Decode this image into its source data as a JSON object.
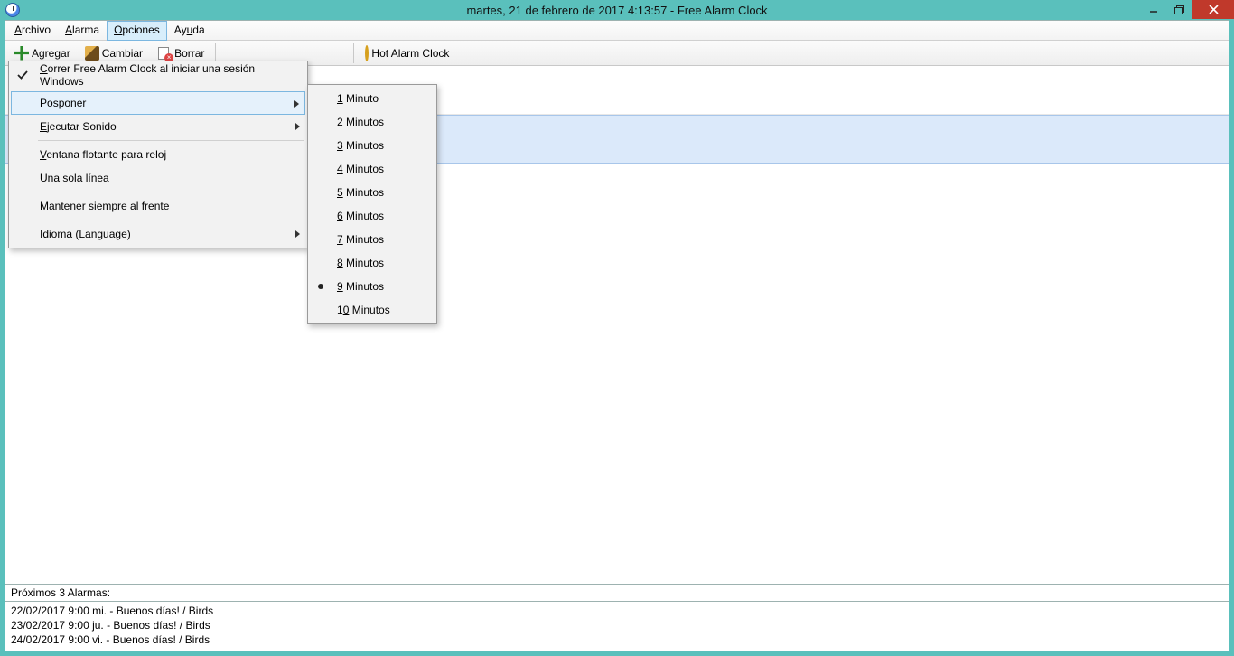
{
  "title": "martes, 21 de febrero de 2017 4:13:57  - Free Alarm Clock",
  "menubar": {
    "archivo": "Archivo",
    "alarma": "Alarma",
    "opciones": "Opciones",
    "ayuda": "Ayuda"
  },
  "toolbar": {
    "agregar": "Agregar",
    "cambiar": "Cambiar",
    "borrar": "Borrar",
    "hot_alarm": "Hot Alarm Clock"
  },
  "options_menu": {
    "correr": "Correr Free Alarm Clock al iniciar una sesión Windows",
    "posponer": "Posponer",
    "ejecutar_sonido": "Ejecutar Sonido",
    "ventana_flotante": "Ventana flotante para reloj",
    "una_sola_linea": "Una sola línea",
    "mantener_frente": "Mantener siempre al frente",
    "idioma": "Idioma (Language)"
  },
  "snooze_menu": {
    "m1": "1 Minuto",
    "m2": "2 Minutos",
    "m3": "3 Minutos",
    "m4": "4 Minutos",
    "m5": "5 Minutos",
    "m6": "6 Minutos",
    "m7": "7 Minutos",
    "m8": "8 Minutos",
    "m9": "9 Minutos",
    "m10": "10 Minutos",
    "selected_index": 8
  },
  "status": {
    "header": "Próximos 3 Alarmas:",
    "l1": "22/02/2017 9:00  mi. - Buenos días! / Birds",
    "l2": "23/02/2017 9:00  ju. - Buenos días! / Birds",
    "l3": "24/02/2017 9:00  vi. - Buenos días! / Birds"
  }
}
